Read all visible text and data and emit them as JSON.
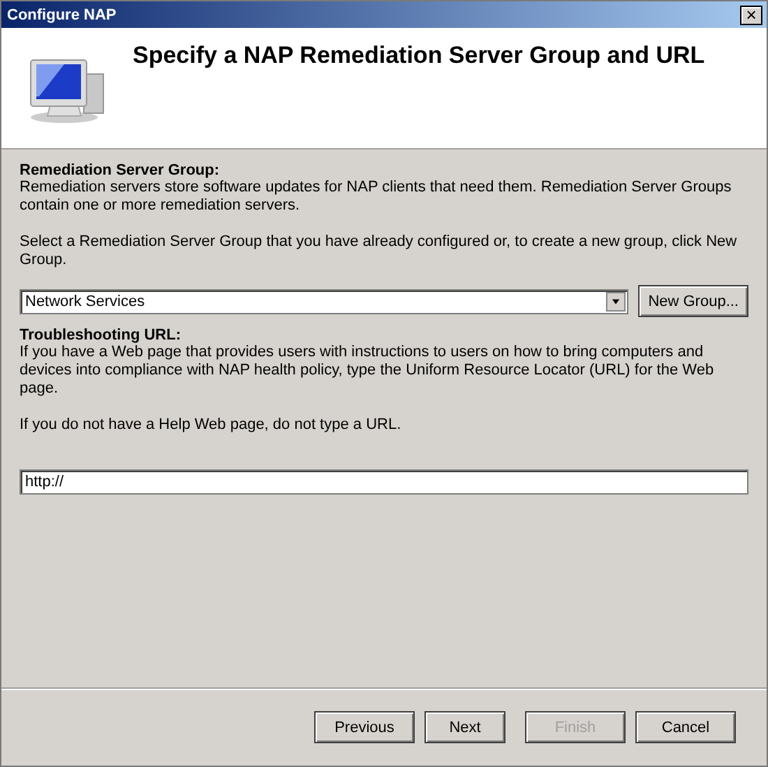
{
  "window": {
    "title": "Configure NAP",
    "close": "×"
  },
  "header": {
    "title": "Specify a NAP Remediation Server Group and URL"
  },
  "remediation": {
    "heading": "Remediation Server Group:",
    "description": "Remediation servers store software updates for NAP clients that need them. Remediation Server Groups contain one or more remediation servers.",
    "instruction": "Select a Remediation Server Group that you have already configured or, to create a new group, click New Group.",
    "dropdown": {
      "value": "Network Services"
    },
    "new_group_button": "New Group..."
  },
  "troubleshooting": {
    "heading": "Troubleshooting URL:",
    "description": "If you have a Web page that provides users with instructions to users on how to bring computers and devices into compliance with NAP health policy, type the Uniform Resource Locator (URL) for the Web page.",
    "note": "If you do not have a Help Web page, do not type a URL.",
    "url_field": {
      "value": "http://"
    }
  },
  "buttons": [
    {
      "label": "Previous",
      "disabled": false
    },
    {
      "label": "Next",
      "disabled": false
    },
    {
      "label": "Finish",
      "disabled": true
    },
    {
      "label": "Cancel",
      "disabled": false
    }
  ]
}
